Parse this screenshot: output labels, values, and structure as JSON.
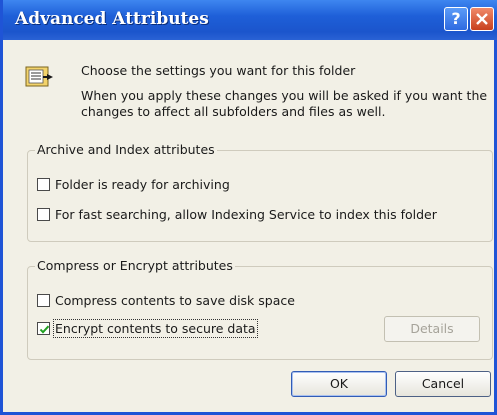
{
  "window": {
    "title": "Advanced Attributes",
    "help_label": "?",
    "close_label": "X"
  },
  "header": {
    "line1": "Choose the settings you want for this folder",
    "line2": "When you apply these changes you will be asked if you want the",
    "line3": "changes to affect all subfolders and files as well."
  },
  "archive_group": {
    "legend": "Archive and Index attributes",
    "items": [
      {
        "label": "Folder is ready for archiving",
        "checked": false
      },
      {
        "label": "For fast searching, allow Indexing Service to index this folder",
        "checked": false
      }
    ]
  },
  "compress_group": {
    "legend": "Compress or Encrypt attributes",
    "items": [
      {
        "label": "Compress contents to save disk space",
        "checked": false
      },
      {
        "label": "Encrypt contents to secure data",
        "checked": true
      }
    ],
    "details_label": "Details"
  },
  "buttons": {
    "ok": "OK",
    "cancel": "Cancel"
  },
  "colors": {
    "title_bar": "#1e5fd8",
    "dialog_bg": "#f2f0e6",
    "check_mark": "#21a121"
  }
}
